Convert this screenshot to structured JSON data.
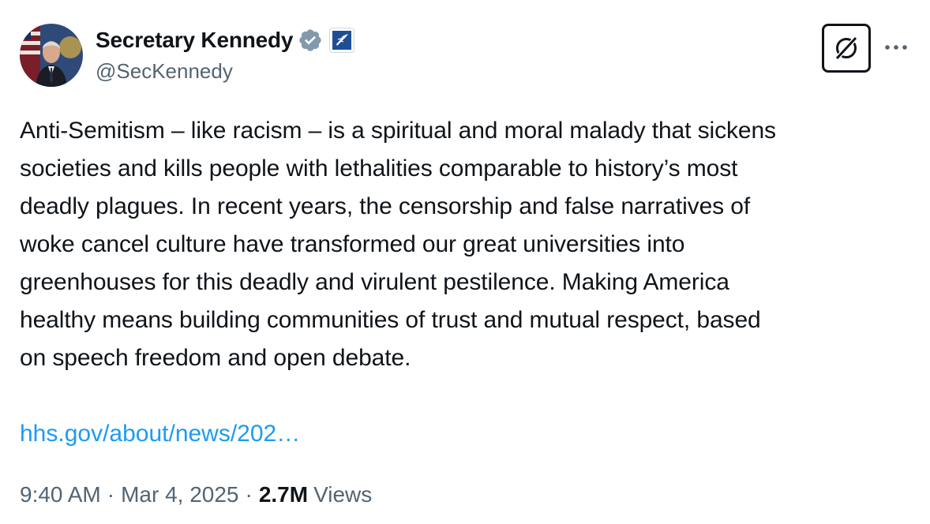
{
  "author": {
    "display_name": "Secretary Kennedy",
    "handle": "@SecKennedy",
    "verified_badge_color": "#829aab",
    "affiliation_badge": "hhs-eagle-logo"
  },
  "tweet": {
    "text": "Anti-Semitism – like racism – is a spiritual and moral malady that sickens\nsocieties and kills people with lethalities comparable to history’s most\ndeadly plagues. In recent years, the censorship and false narratives of\nwoke cancel culture have transformed our great universities into\ngreenhouses for this deadly and virulent pestilence. Making America\nhealthy means building communities of trust and mutual respect, based\non speech freedom and open debate.",
    "link_text": "hhs.gov/about/news/202…"
  },
  "meta": {
    "time": "9:40 AM",
    "date": "Mar 4, 2025",
    "separator": "·",
    "views_count": "2.7M",
    "views_label": "Views"
  },
  "actions": {
    "grok_icon": "grok-icon",
    "more_icon": "more-horizontal-icon"
  },
  "colors": {
    "text": "#0f1419",
    "secondary": "#536471",
    "link": "#1d9bf0"
  }
}
